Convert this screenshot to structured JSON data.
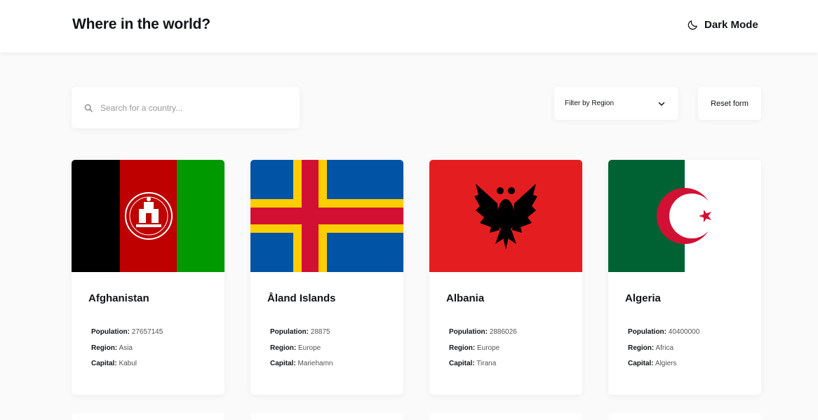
{
  "header": {
    "title": "Where in the world?",
    "dark_mode_label": "Dark Mode",
    "dark_mode_icon": "moon-icon"
  },
  "search": {
    "placeholder": "Search for a country...",
    "value": "",
    "icon": "search-icon"
  },
  "filter": {
    "selected_label": "Filter by Region",
    "icon": "chevron-down-icon"
  },
  "reset_label": "Reset form",
  "labels": {
    "population": "Population:",
    "region": "Region:",
    "capital": "Capital:"
  },
  "countries": [
    {
      "name": "Afghanistan",
      "population": "27657145",
      "region": "Asia",
      "capital": "Kabul",
      "flag": "afghanistan-flag",
      "colors": [
        "#000000",
        "#be0000",
        "#009900"
      ]
    },
    {
      "name": "Åland Islands",
      "population": "28875",
      "region": "Europe",
      "capital": "Mariehamn",
      "flag": "aland-islands-flag",
      "colors": [
        "#0053a5",
        "#ffce00",
        "#d21034"
      ]
    },
    {
      "name": "Albania",
      "population": "2886026",
      "region": "Europe",
      "capital": "Tirana",
      "flag": "albania-flag",
      "colors": [
        "#e41e20",
        "#000000"
      ]
    },
    {
      "name": "Algeria",
      "population": "40400000",
      "region": "Africa",
      "capital": "Algiers",
      "flag": "algeria-flag",
      "colors": [
        "#006233",
        "#ffffff",
        "#d21034"
      ]
    }
  ]
}
